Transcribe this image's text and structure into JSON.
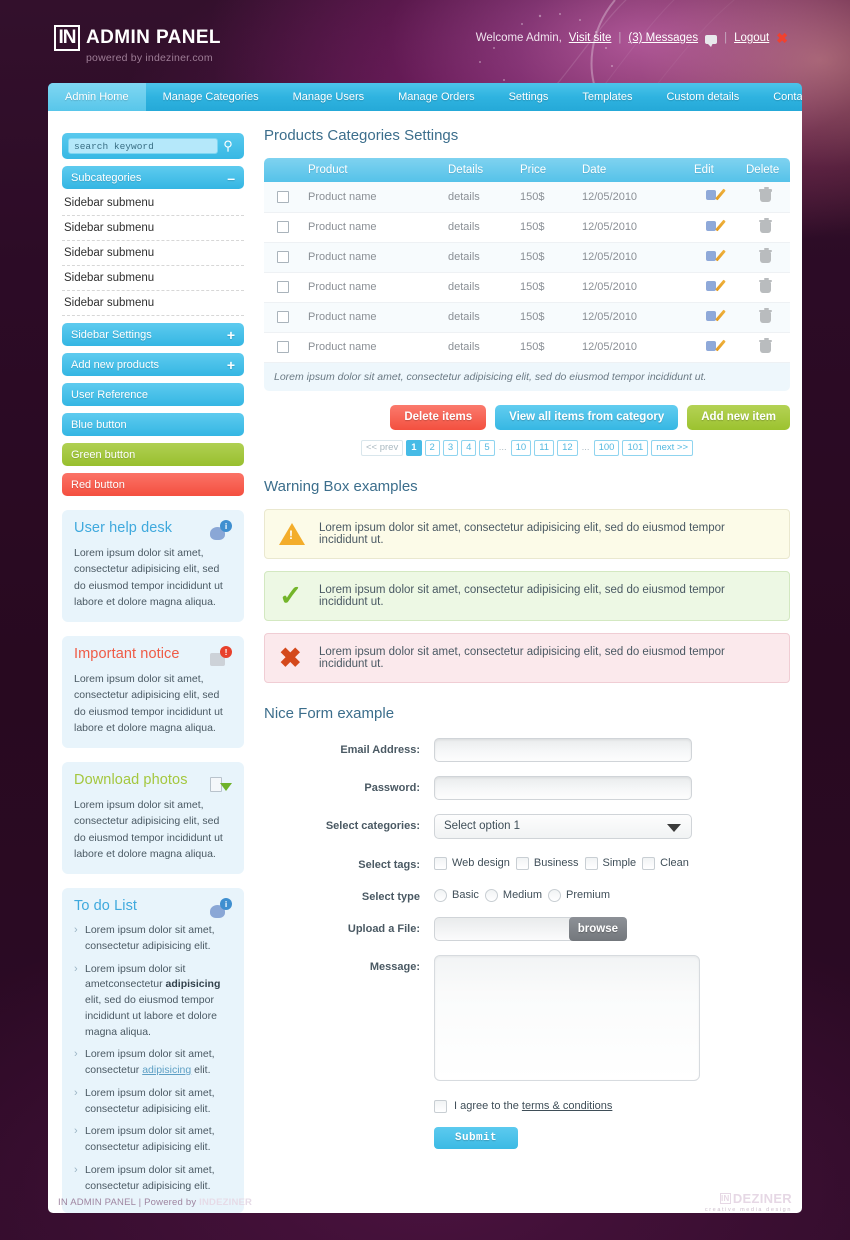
{
  "header": {
    "logo_mark": "IN",
    "logo_title": "ADMIN PANEL",
    "logo_sub": "powered by indeziner.com",
    "welcome": "Welcome Admin,",
    "visit_site": "Visit site",
    "messages": "(3) Messages",
    "logout": "Logout",
    "sep": "|",
    "close_glyph": "✖"
  },
  "nav": {
    "items": [
      {
        "label": "Admin Home",
        "active": true
      },
      {
        "label": "Manage Categories",
        "active": false
      },
      {
        "label": "Manage Users",
        "active": false
      },
      {
        "label": "Manage Orders",
        "active": false
      },
      {
        "label": "Settings",
        "active": false
      },
      {
        "label": "Templates",
        "active": false
      },
      {
        "label": "Custom details",
        "active": false
      },
      {
        "label": "Contact",
        "active": false
      }
    ]
  },
  "sidebar": {
    "search": {
      "value": "search keyword",
      "placeholder": "search keyword",
      "icon": "search-icon"
    },
    "subcategories": {
      "label": "Subcategories",
      "toggle": "–"
    },
    "submenu_items": [
      "Sidebar submenu",
      "Sidebar submenu",
      "Sidebar submenu",
      "Sidebar submenu",
      "Sidebar submenu"
    ],
    "buttons": [
      {
        "label": "Sidebar Settings",
        "toggle": "+",
        "color": "blue"
      },
      {
        "label": "Add new products",
        "toggle": "+",
        "color": "blue"
      },
      {
        "label": "User Reference",
        "toggle": "",
        "color": "blue"
      },
      {
        "label": "Blue button",
        "toggle": "",
        "color": "blue"
      },
      {
        "label": "Green button",
        "toggle": "",
        "color": "green"
      },
      {
        "label": "Red button",
        "toggle": "",
        "color": "red"
      }
    ],
    "boxes": [
      {
        "title": "User help desk",
        "color_class": "c-blue",
        "icon": "user-info-icon",
        "badge": "i",
        "badge_color": "blue",
        "text": "Lorem ipsum dolor sit amet, consectetur adipisicing elit, sed do eiusmod tempor incididunt ut labore et dolore magna aliqua."
      },
      {
        "title": "Important notice",
        "color_class": "c-red",
        "icon": "alert-document-icon",
        "badge": "!",
        "badge_color": "red",
        "text": "Lorem ipsum dolor sit amet, consectetur adipisicing elit, sed do eiusmod tempor incididunt ut labore et dolore magna aliqua."
      },
      {
        "title": "Download photos",
        "color_class": "c-green",
        "icon": "download-icon",
        "badge": "",
        "badge_color": "green",
        "text": "Lorem ipsum dolor sit amet, consectetur adipisicing elit, sed do eiusmod tempor incididunt ut labore et dolore magna aliqua."
      }
    ],
    "todo": {
      "title": "To do List",
      "color_class": "c-blue",
      "icon": "user-info-icon",
      "badge": "i",
      "items": [
        {
          "text": "Lorem ipsum dolor sit amet, consectetur adipisicing elit.",
          "bold": "",
          "link": "",
          "tail": ""
        },
        {
          "text": "Lorem ipsum dolor sit ametconsectetur ",
          "bold": "adipisicing",
          "link": "",
          "tail": " elit, sed do eiusmod tempor incididunt ut labore et dolore magna aliqua."
        },
        {
          "text": "Lorem ipsum dolor sit amet, consectetur ",
          "bold": "",
          "link": "adipisicing",
          "tail": " elit."
        },
        {
          "text": "Lorem ipsum dolor sit amet, consectetur adipisicing elit.",
          "bold": "",
          "link": "",
          "tail": ""
        },
        {
          "text": "Lorem ipsum dolor sit amet, consectetur adipisicing elit.",
          "bold": "",
          "link": "",
          "tail": ""
        },
        {
          "text": "Lorem ipsum dolor sit amet, consectetur adipisicing elit.",
          "bold": "",
          "link": "",
          "tail": ""
        }
      ]
    }
  },
  "main": {
    "table_title": "Products Categories Settings",
    "table": {
      "headers": [
        "",
        "Product",
        "Details",
        "Price",
        "Date",
        "Edit",
        "Delete"
      ],
      "rows": [
        {
          "product": "Product name",
          "details": "details",
          "price": "150$",
          "date": "12/05/2010"
        },
        {
          "product": "Product name",
          "details": "details",
          "price": "150$",
          "date": "12/05/2010"
        },
        {
          "product": "Product name",
          "details": "details",
          "price": "150$",
          "date": "12/05/2010"
        },
        {
          "product": "Product name",
          "details": "details",
          "price": "150$",
          "date": "12/05/2010"
        },
        {
          "product": "Product name",
          "details": "details",
          "price": "150$",
          "date": "12/05/2010"
        },
        {
          "product": "Product name",
          "details": "details",
          "price": "150$",
          "date": "12/05/2010"
        }
      ],
      "note": "Lorem ipsum dolor sit amet, consectetur adipisicing elit, sed do eiusmod tempor incididunt ut."
    },
    "actions": [
      {
        "label": "Delete items",
        "color": "red"
      },
      {
        "label": "View all items from category",
        "color": "blue"
      },
      {
        "label": "Add new item",
        "color": "green"
      }
    ],
    "pagination": {
      "prev": "<< prev",
      "next": "next >>",
      "pages": [
        "1",
        "2",
        "3",
        "4",
        "5",
        "...",
        "10",
        "11",
        "12",
        "...",
        "100",
        "101"
      ],
      "active": "1"
    },
    "warning_title": "Warning Box examples",
    "alerts": [
      {
        "type": "warn",
        "icon": "warning-triangle-icon",
        "text": "Lorem ipsum dolor sit amet, consectetur adipisicing elit, sed do eiusmod tempor incididunt ut."
      },
      {
        "type": "ok",
        "icon": "checkmark-icon",
        "text": "Lorem ipsum dolor sit amet, consectetur adipisicing elit, sed do eiusmod tempor incididunt ut."
      },
      {
        "type": "err",
        "icon": "error-cross-icon",
        "text": "Lorem ipsum dolor sit amet, consectetur adipisicing elit, sed do eiusmod tempor incididunt ut."
      }
    ],
    "form_title": "Nice Form example",
    "form": {
      "email_label": "Email Address:",
      "email_value": "",
      "password_label": "Password:",
      "password_value": "",
      "select_label": "Select categories:",
      "select_value": "Select option 1",
      "tags_label": "Select tags:",
      "tags": [
        "Web design",
        "Business",
        "Simple",
        "Clean"
      ],
      "type_label": "Select type",
      "types": [
        "Basic",
        "Medium",
        "Premium"
      ],
      "upload_label": "Upload a File:",
      "upload_value": "",
      "browse_label": "browse",
      "message_label": "Message:",
      "message_value": "",
      "agree_prefix": "I agree to the ",
      "agree_link": "terms & conditions",
      "submit_label": "Submit"
    }
  },
  "footer": {
    "left_plain": "IN ADMIN PANEL | Powered by ",
    "left_bold": "INDEZINER",
    "brand_mark": "IN",
    "brand_name": "DEZINER",
    "brand_sub": "creative media design"
  }
}
